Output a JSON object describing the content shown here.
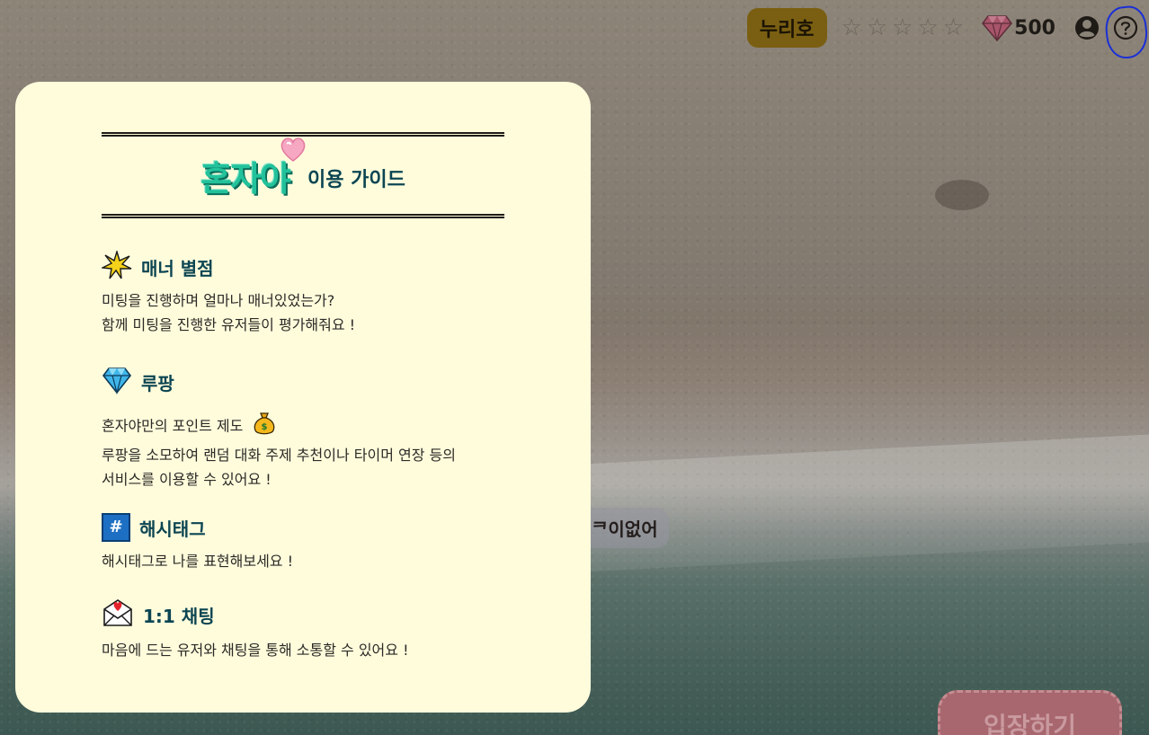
{
  "topbar": {
    "nickname": "누리호",
    "rating": {
      "value": 0,
      "max": 5
    },
    "gem_points": "500",
    "icons": [
      "star-icon",
      "gem-icon",
      "user-icon",
      "help-icon"
    ]
  },
  "background": {
    "chip_text": "ᄏ이없어",
    "enter_button": "입장하기"
  },
  "guide": {
    "logo": "혼자야",
    "title": "이용 가이드",
    "sections": [
      {
        "icon": "sparkle-star-icon",
        "title": "매너 별점",
        "lines": [
          "미팅을 진행하며 얼마나 매너있었는가?",
          "함께 미팅을 진행한 유저들이 평가해줘요 !"
        ]
      },
      {
        "icon": "diamond-icon",
        "title": "루팡",
        "lines": [
          "혼자야만의 포인트 제도",
          "루팡을 소모하여 랜덤 대화 주제 추천이나 타이머 연장 등의",
          "서비스를 이용할 수 있어요 !"
        ]
      },
      {
        "icon": "hash-icon",
        "icon_text": "#",
        "title": "해시태그",
        "lines": [
          "해시태그로 나를 표현해보세요 !"
        ]
      },
      {
        "icon": "love-letter-icon",
        "title": "1:1 채팅",
        "lines": [
          "마음에 드는 유저와 채팅을 통해 소통할 수 있어요 !"
        ]
      }
    ]
  },
  "colors": {
    "guide_bg": "#fffcdc",
    "title_teal": "#0c4552",
    "logo_green": "#22c29b",
    "nickname_bg": "#7a5f12"
  }
}
